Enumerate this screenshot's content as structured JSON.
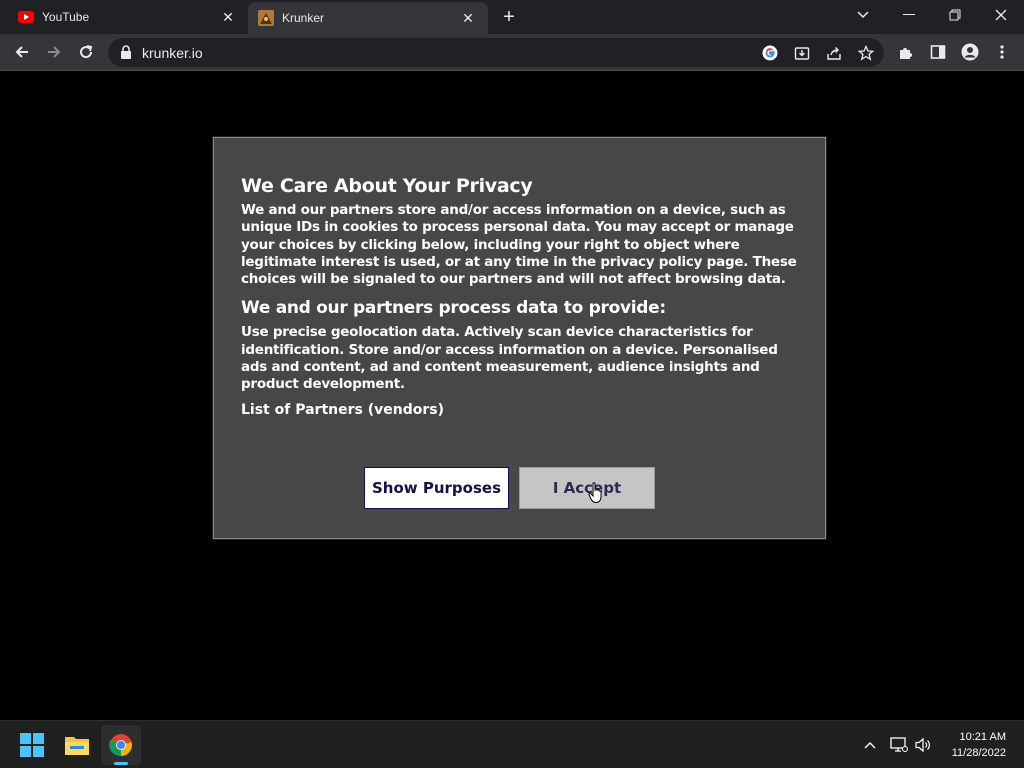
{
  "browser": {
    "tabs": [
      {
        "title": "YouTube",
        "icon": "youtube-icon",
        "active": false
      },
      {
        "title": "Krunker",
        "icon": "krunker-icon",
        "active": true
      }
    ],
    "address": "krunker.io"
  },
  "dialog": {
    "title": "We Care About Your Privacy",
    "intro": "We and our partners store and/or access information on a device, such as unique IDs in cookies to process personal data. You may accept or manage your choices by clicking below, including your right to object where legitimate interest is used, or at any time in the privacy policy page. These choices will be signaled to our partners and will not affect browsing data.",
    "subtitle": "We and our partners process data to provide:",
    "purposes": "Use precise geolocation data. Actively scan device characteristics for identification. Store and/or access information on a device. Personalised ads and content, ad and content measurement, audience insights and product development.",
    "vendors_link": "List of Partners (vendors)",
    "show_purposes_label": "Show Purposes",
    "accept_label": "I Accept"
  },
  "taskbar": {
    "time": "10:21 AM",
    "date": "11/28/2022"
  },
  "colors": {
    "tabbar": "#202124",
    "toolbar": "#35363a",
    "dialog_bg": "#474747",
    "accent": "#4cc2ff"
  }
}
